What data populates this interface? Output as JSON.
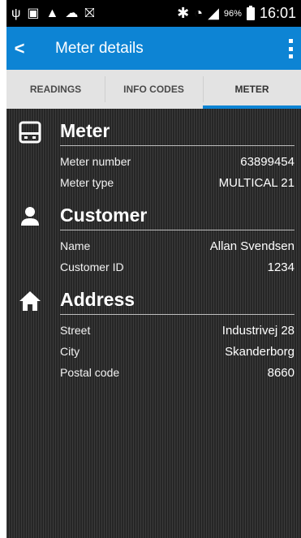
{
  "statusbar": {
    "battery_pct": "96%",
    "time": "16:01"
  },
  "appbar": {
    "back_icon": "chevron-left-icon",
    "title": "Meter details",
    "overflow_icon": "more-vertical-icon"
  },
  "tabs": [
    {
      "label": "READINGS",
      "active": false
    },
    {
      "label": "INFO CODES",
      "active": false
    },
    {
      "label": "METER",
      "active": true
    }
  ],
  "sections": {
    "meter": {
      "icon": "meter-icon",
      "title": "Meter",
      "rows": [
        {
          "label": "Meter number",
          "value": "63899454"
        },
        {
          "label": "Meter type",
          "value": "MULTICAL 21"
        }
      ]
    },
    "customer": {
      "icon": "person-icon",
      "title": "Customer",
      "rows": [
        {
          "label": "Name",
          "value": "Allan Svendsen"
        },
        {
          "label": "Customer ID",
          "value": "1234"
        }
      ]
    },
    "address": {
      "icon": "home-icon",
      "title": "Address",
      "rows": [
        {
          "label": "Street",
          "value": "Industrivej 28"
        },
        {
          "label": "City",
          "value": "Skanderborg"
        },
        {
          "label": "Postal code",
          "value": "8660"
        }
      ]
    }
  },
  "colors": {
    "accent": "#0d84d4",
    "tab_bg": "#e3e3e3",
    "content_bg": "#2a2a2a"
  }
}
